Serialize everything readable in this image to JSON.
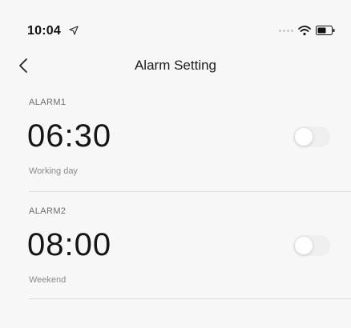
{
  "status_bar": {
    "time": "10:04",
    "icons": [
      "location-arrow-icon",
      "signal-dots-icon",
      "wifi-icon",
      "battery-icon"
    ]
  },
  "nav": {
    "back_icon": "chevron-left-icon",
    "title": "Alarm Setting"
  },
  "alarms": [
    {
      "name": "ALARM1",
      "time": "06:30",
      "repeat": "Working day",
      "enabled": false
    },
    {
      "name": "ALARM2",
      "time": "08:00",
      "repeat": "Weekend",
      "enabled": false
    }
  ],
  "colors": {
    "background": "#f7f7f7",
    "text_primary": "#151515",
    "text_secondary": "#8a8a8a",
    "toggle_off": "#efefef",
    "divider": "#dedede"
  }
}
